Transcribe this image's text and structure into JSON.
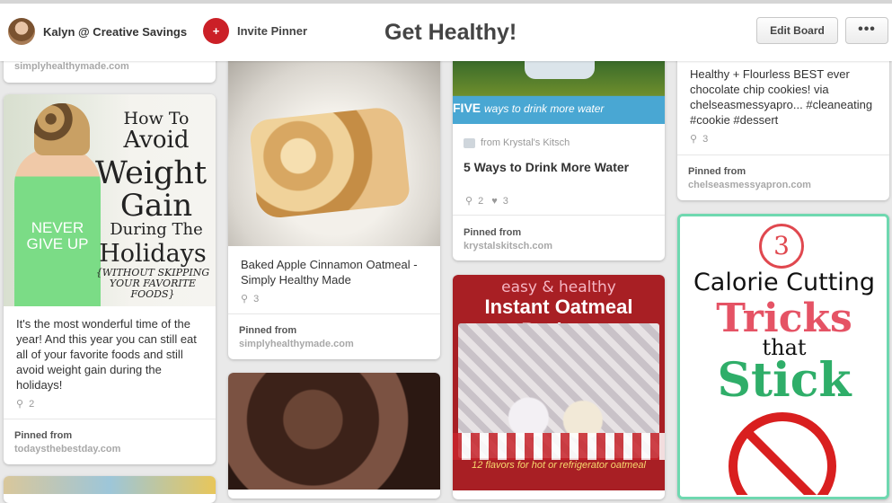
{
  "header": {
    "owner_name": "Kalyn @ Creative Savings",
    "invite_label": "Invite Pinner",
    "board_title": "Get Healthy!",
    "edit_board_label": "Edit Board",
    "more_label": "•••"
  },
  "col1": {
    "top_card": {
      "source": "simplyhealthymade.com"
    },
    "weight_card": {
      "image_text": {
        "line1": "How To",
        "line2": "Avoid",
        "line3": "Weight",
        "line4": "Gain",
        "line5": "During The",
        "line6": "Holidays",
        "line7": "{WITHOUT SKIPPING YOUR FAVORITE FOODS}",
        "shirt": "NEVER GIVE UP"
      },
      "description": "It's the most wonderful time of the year! And this year you can still eat all of your favorite foods and still avoid weight gain during the holidays!",
      "repins": "2",
      "pinned_from_label": "Pinned from",
      "source": "todaysthebestday.com"
    }
  },
  "col2": {
    "oatmeal_card": {
      "description": "Baked Apple Cinnamon Oatmeal - Simply Healthy Made",
      "repins": "3",
      "pinned_from_label": "Pinned from",
      "source": "simplyhealthymade.com"
    }
  },
  "col3": {
    "water_card": {
      "image_text_big": "FIVE",
      "image_text_small": "ways to drink more water",
      "attribution": "from Krystal's Kitsch",
      "title": "5 Ways to Drink More Water",
      "repins": "2",
      "likes": "3",
      "pinned_from_label": "Pinned from",
      "source": "krystalskitsch.com"
    },
    "packets_card": {
      "image_text_top": "easy & healthy",
      "image_text_title": "Instant Oatmeal Packets",
      "image_text_foot": "12 flavors for hot or refrigerator oatmeal"
    }
  },
  "col4": {
    "cookie_card": {
      "description": "Healthy + Flourless BEST ever chocolate chip cookies! via chelseasmessyapro... #cleaneating #cookie #dessert",
      "repins": "3",
      "pinned_from_label": "Pinned from",
      "source": "chelseasmessyapron.com"
    },
    "calorie_card": {
      "image_text": {
        "number": "3",
        "line1": "Calorie Cutting",
        "line2": "Tricks",
        "line3": "that",
        "line4": "Stick"
      }
    }
  },
  "icons": {
    "repin": "pin-icon",
    "like": "heart-icon",
    "invite": "add-person-icon"
  },
  "colors": {
    "brand_red": "#cb2027",
    "calorie_border": "#6fd8b0",
    "background": "#e9e9e9"
  }
}
